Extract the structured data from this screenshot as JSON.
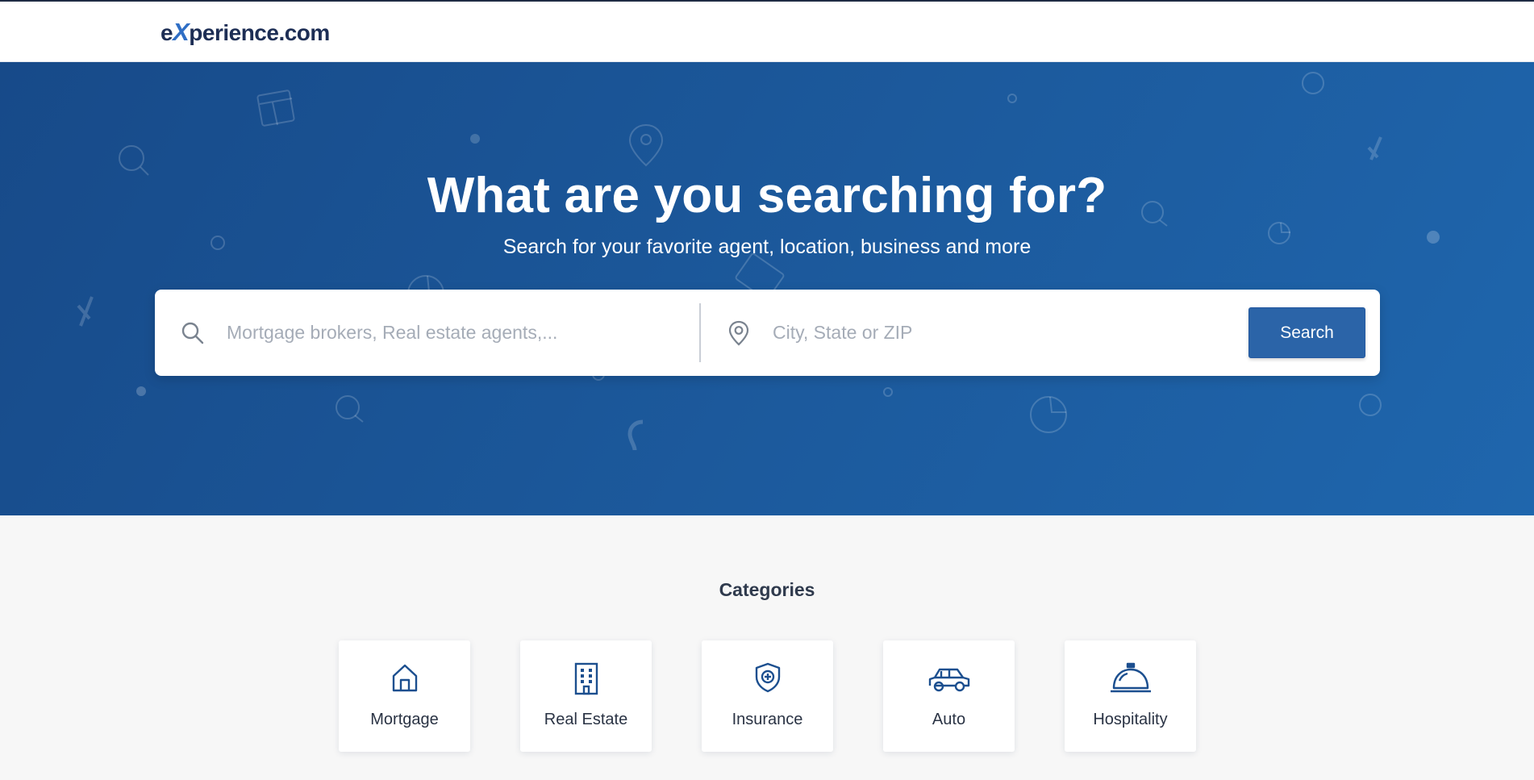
{
  "header": {
    "logo_prefix": "e",
    "logo_x": "X",
    "logo_suffix": "perience.com"
  },
  "hero": {
    "title": "What are you searching for?",
    "subtitle": "Search for your favorite agent, location, business and more"
  },
  "search": {
    "what_placeholder": "Mortgage brokers, Real estate agents,...",
    "what_value": "",
    "where_placeholder": "City, State or ZIP",
    "where_value": "",
    "button_label": "Search",
    "what_icon": "search-icon",
    "where_icon": "map-pin-icon"
  },
  "categories": {
    "title": "Categories",
    "items": [
      {
        "label": "Mortgage",
        "icon": "home-icon"
      },
      {
        "label": "Real Estate",
        "icon": "building-icon"
      },
      {
        "label": "Insurance",
        "icon": "shield-plus-icon"
      },
      {
        "label": "Auto",
        "icon": "car-icon"
      },
      {
        "label": "Hospitality",
        "icon": "service-bell-icon"
      }
    ]
  },
  "colors": {
    "brand_navy": "#1d2e55",
    "brand_blue": "#2f6ec5",
    "hero_bg": "#1c5a9d",
    "button": "#2b64a8",
    "icon": "#1c4f8f"
  }
}
